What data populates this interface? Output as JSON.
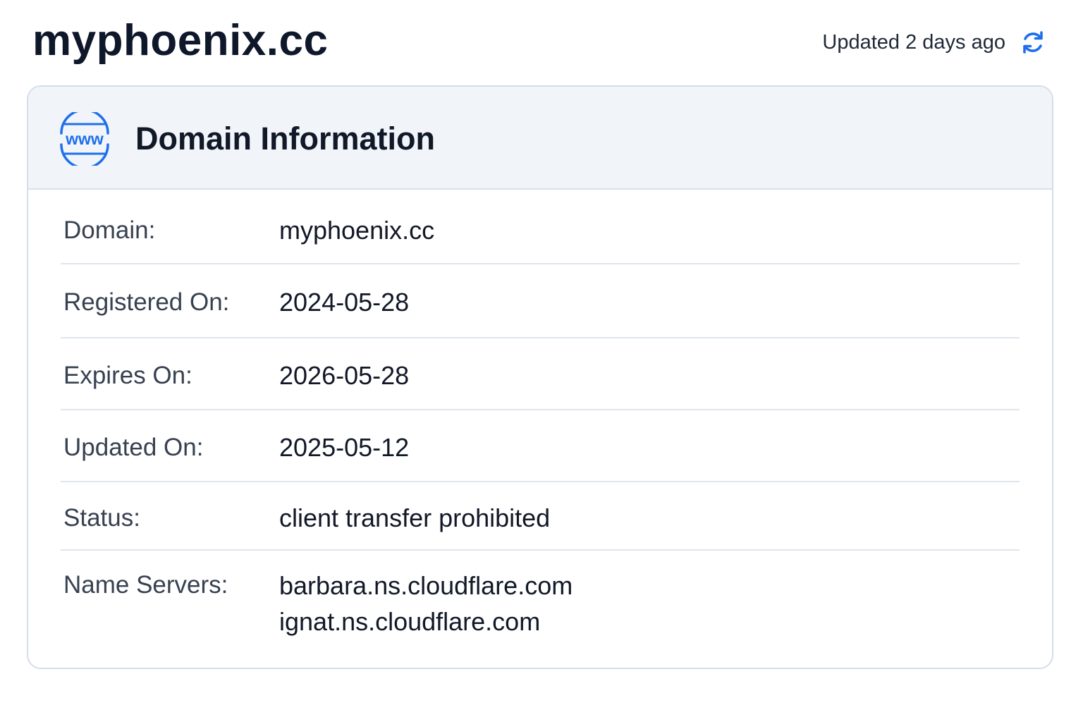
{
  "header": {
    "title": "myphoenix.cc",
    "updated_text": "Updated 2 days ago",
    "refresh_icon": "refresh-icon"
  },
  "card": {
    "icon": "www-globe-icon",
    "icon_text": "www",
    "title": "Domain Information",
    "rows": [
      {
        "label": "Domain:",
        "value": "myphoenix.cc"
      },
      {
        "label": "Registered On:",
        "value": "2024-05-28"
      },
      {
        "label": "Expires On:",
        "value": "2026-05-28"
      },
      {
        "label": "Updated On:",
        "value": "2025-05-12"
      },
      {
        "label": "Status:",
        "value": "client transfer prohibited"
      },
      {
        "label": "Name Servers:",
        "values": [
          "barbara.ns.cloudflare.com",
          "ignat.ns.cloudflare.com"
        ]
      }
    ]
  },
  "colors": {
    "accent": "#1f6feb",
    "header_bg": "#f1f5fa",
    "border": "#d5dde8",
    "text": "#111827",
    "label": "#374151"
  }
}
